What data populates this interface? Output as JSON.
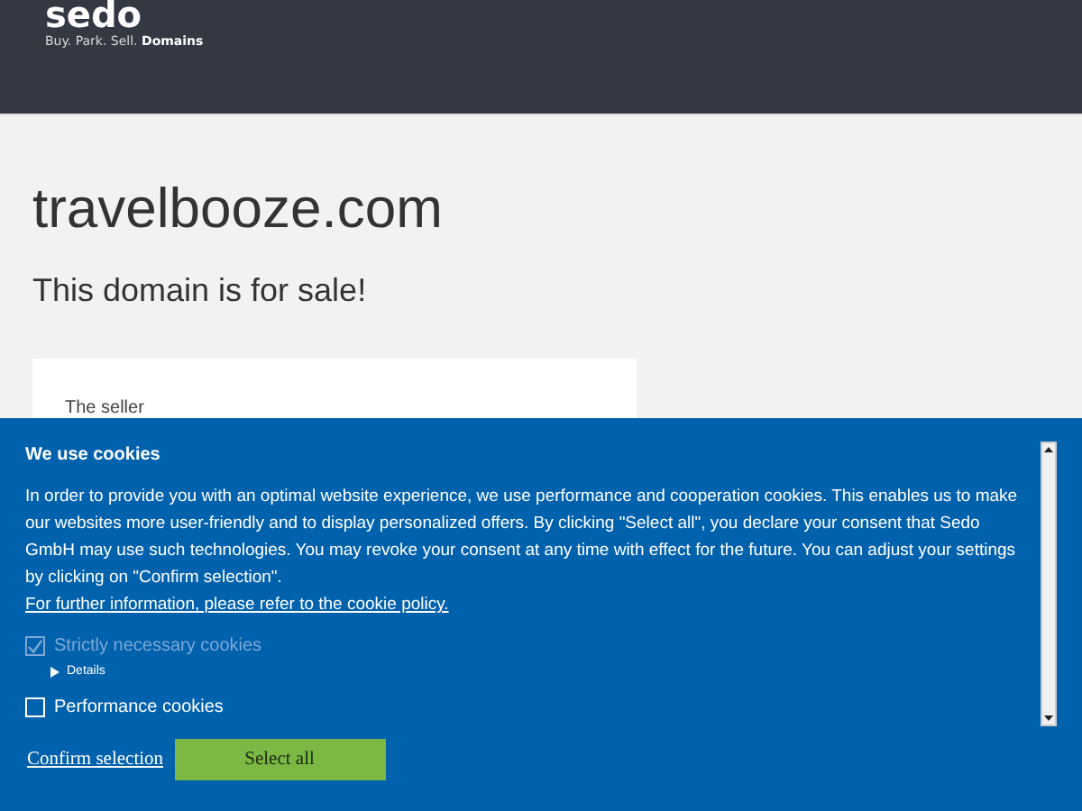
{
  "header": {
    "logo": "sedo",
    "tagline_prefix": "Buy. Park. Sell.",
    "tagline_bold": "Domains"
  },
  "domain": "travelbooze.com",
  "subtitle": "This domain is for sale!",
  "card": {
    "heading": "The seller"
  },
  "cookie_banner": {
    "title": "We use cookies",
    "text": "In order to provide you with an optimal website experience, we use performance and cooperation cookies. This enables us to make our websites more user-friendly and to display personalized offers. By clicking \"Select all\", you declare your consent that Sedo GmbH may use such technologies. You may revoke your consent at any time with effect for the future. You can adjust your settings by clicking on \"Confirm selection\".",
    "policy_link": "For further information, please refer to the cookie policy.",
    "options": [
      {
        "label": "Strictly necessary cookies",
        "checked": true,
        "disabled": true,
        "details": "Details"
      },
      {
        "label": "Performance cookies",
        "checked": false,
        "disabled": false
      }
    ],
    "confirm": "Confirm selection",
    "select_all": "Select all"
  }
}
